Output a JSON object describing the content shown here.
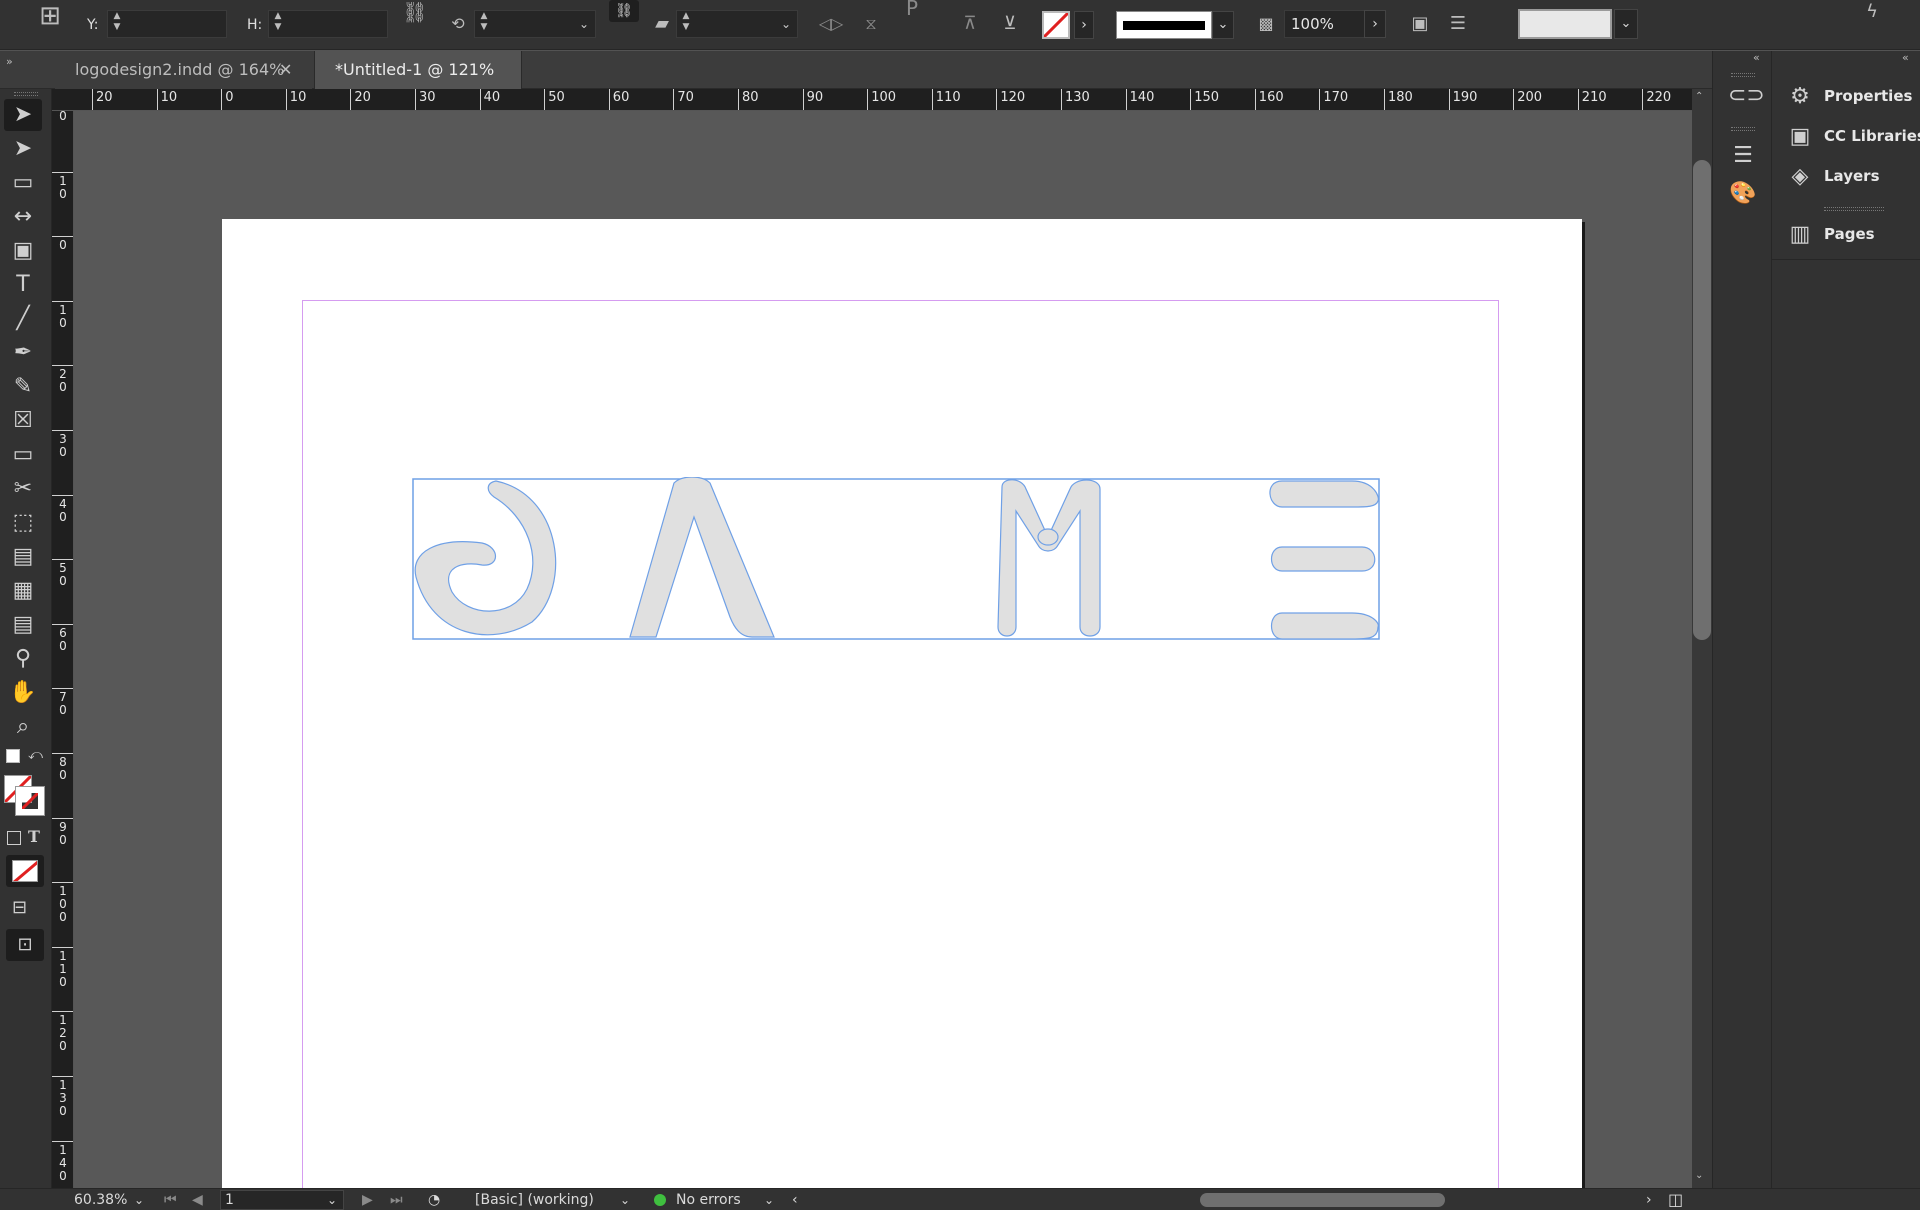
{
  "control_bar": {
    "y_label": "Y:",
    "h_label": "H:",
    "stroke_weight_value": "",
    "opacity_value": "100%",
    "stroke_style": "",
    "fill_none": true
  },
  "tabs": [
    {
      "label": "logodesign2.indd @ 164%",
      "active": false
    },
    {
      "label": "*Untitled-1 @ 121%",
      "active": true
    }
  ],
  "tools": [
    {
      "name": "selection-tool",
      "glyph": "➤"
    },
    {
      "name": "direct-selection-tool",
      "glyph": "➤"
    },
    {
      "name": "page-tool",
      "glyph": "▭"
    },
    {
      "name": "gap-tool",
      "glyph": "↔"
    },
    {
      "name": "content-collector-tool",
      "glyph": "▣"
    },
    {
      "name": "type-tool",
      "glyph": "T"
    },
    {
      "name": "line-tool",
      "glyph": "╱"
    },
    {
      "name": "pen-tool",
      "glyph": "✒"
    },
    {
      "name": "pencil-tool",
      "glyph": "✎"
    },
    {
      "name": "rectangle-frame-tool",
      "glyph": "☒"
    },
    {
      "name": "rectangle-tool",
      "glyph": "▭"
    },
    {
      "name": "scissors-tool",
      "glyph": "✂"
    },
    {
      "name": "free-transform-tool",
      "glyph": "⬚"
    },
    {
      "name": "gradient-swatch-tool",
      "glyph": "▤"
    },
    {
      "name": "gradient-feather-tool",
      "glyph": "▦"
    },
    {
      "name": "note-tool",
      "glyph": "▤"
    },
    {
      "name": "eyedropper-tool",
      "glyph": "⚲"
    },
    {
      "name": "hand-tool",
      "glyph": "✋"
    },
    {
      "name": "zoom-tool",
      "glyph": "⌕"
    }
  ],
  "horizontal_ruler": [
    "20",
    "10",
    "0",
    "10",
    "20",
    "30",
    "40",
    "50",
    "60",
    "70",
    "80",
    "90",
    "100",
    "110",
    "120",
    "130",
    "140",
    "150",
    "160",
    "170",
    "180",
    "190",
    "200",
    "210",
    "220"
  ],
  "vertical_ruler": [
    "0",
    "10",
    "0",
    "10",
    "20",
    "30",
    "40",
    "50",
    "60",
    "70",
    "80",
    "90",
    "100",
    "110",
    "120",
    "130",
    "140"
  ],
  "panels": [
    {
      "label": "Properties",
      "icon": "properties-icon"
    },
    {
      "label": "CC Libraries",
      "icon": "cc-libraries-icon"
    },
    {
      "label": "Layers",
      "icon": "layers-icon"
    },
    {
      "label": "Pages",
      "icon": "pages-icon"
    }
  ],
  "status_bar": {
    "zoom": "60.38%",
    "page_number": "1",
    "preflight_profile": "[Basic] (working)",
    "preflight_status": "No errors"
  },
  "colors": {
    "selection": "#6fa0e6",
    "margin_guide": "#d59cf0",
    "glyph_fill": "#e0e0e0",
    "ok_status": "#3fbf3f"
  }
}
